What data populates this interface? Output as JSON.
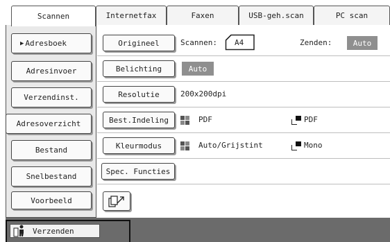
{
  "tabs": [
    {
      "label": "Scannen",
      "active": true
    },
    {
      "label": "Internetfax",
      "active": false
    },
    {
      "label": "Faxen",
      "active": false
    },
    {
      "label": "USB-geh.scan",
      "active": false
    },
    {
      "label": "PC scan",
      "active": false
    }
  ],
  "sidebar": {
    "items": [
      {
        "label": "Adresboek",
        "selected": true
      },
      {
        "label": "Adresinvoer"
      },
      {
        "label": "Verzendinst."
      },
      {
        "label": "Adresoverzicht"
      },
      {
        "label": "Bestand"
      },
      {
        "label": "Snelbestand"
      },
      {
        "label": "Voorbeeld"
      }
    ]
  },
  "settings": {
    "origineel": {
      "button": "Origineel",
      "scan_label": "Scannen:",
      "scan_value": "A4",
      "send_label": "Zenden:",
      "send_value": "Auto"
    },
    "belichting": {
      "button": "Belichting",
      "value": "Auto"
    },
    "resolutie": {
      "button": "Resolutie",
      "value": "200x200dpi"
    },
    "bestand": {
      "button": "Best.Indeling",
      "color_format": "PDF",
      "mono_format": "PDF"
    },
    "kleurmodus": {
      "button": "Kleurmodus",
      "color_value": "Auto/Grijstint",
      "mono_value": "Mono"
    },
    "spec": {
      "button": "Spec. Functies"
    },
    "preview": {
      "icon": "document-rotate-icon"
    }
  },
  "bottom": {
    "send_label": "Verzenden",
    "icon": "send-person-icon"
  },
  "colors": {
    "badge": "#8f8f8f",
    "bottom_bar": "#6b6b6b",
    "sidebar_bg": "#e9e9e9"
  }
}
